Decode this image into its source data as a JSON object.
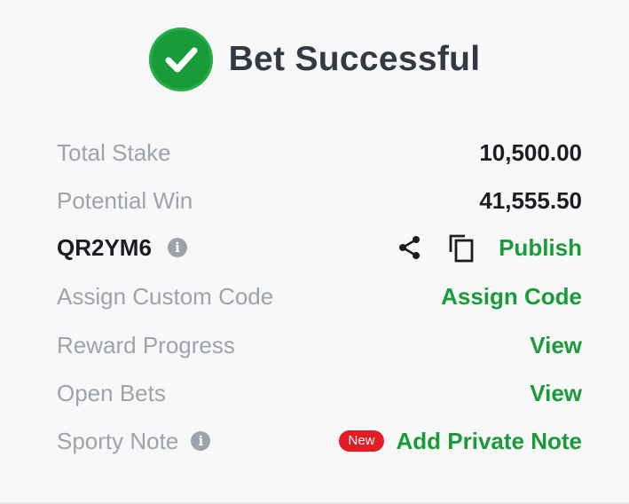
{
  "header": {
    "title": "Bet Successful",
    "icon": "check-circle-icon",
    "accent": "#1a9b3a"
  },
  "summary": {
    "total_stake_label": "Total Stake",
    "total_stake_value": "10,500.00",
    "potential_win_label": "Potential Win",
    "potential_win_value": "41,555.50"
  },
  "booking": {
    "code": "QR2YM6",
    "share_icon": "share-icon",
    "copy_icon": "copy-icon",
    "publish_label": "Publish"
  },
  "actions": {
    "assign_label": "Assign Custom Code",
    "assign_link": "Assign Code",
    "reward_label": "Reward Progress",
    "reward_link": "View",
    "open_bets_label": "Open Bets",
    "open_bets_link": "View",
    "note_label": "Sporty Note",
    "note_badge": "New",
    "note_link": "Add Private Note"
  }
}
